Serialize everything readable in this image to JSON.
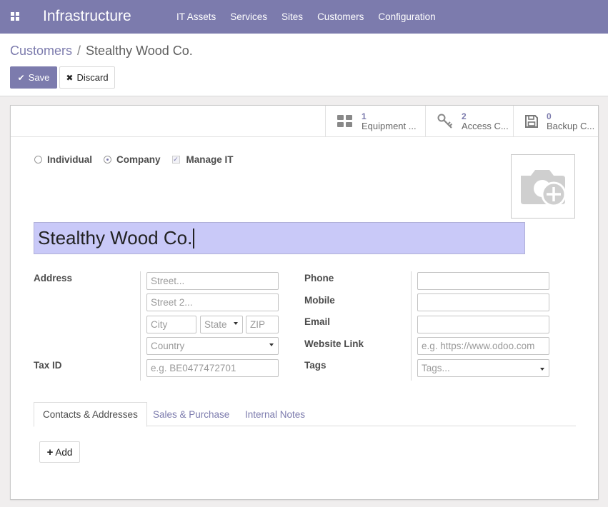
{
  "navbar": {
    "app_title": "Infrastructure",
    "menu": [
      "IT Assets",
      "Services",
      "Sites",
      "Customers",
      "Configuration"
    ]
  },
  "breadcrumb": {
    "parent": "Customers",
    "separator": "/",
    "current": "Stealthy Wood Co."
  },
  "actions": {
    "save_label": "Save",
    "discard_label": "Discard"
  },
  "stat_buttons": [
    {
      "count": "1",
      "label": "Equipment ...",
      "icon": "grid-icon"
    },
    {
      "count": "2",
      "label": "Access C...",
      "icon": "key-icon"
    },
    {
      "count": "0",
      "label": "Backup C...",
      "icon": "floppy-icon"
    }
  ],
  "type_options": {
    "individual": "Individual",
    "company": "Company",
    "manage_it": "Manage IT",
    "selected": "Company",
    "manage_it_checked": true
  },
  "name": "Stealthy Wood Co.",
  "address": {
    "label": "Address",
    "street_placeholder": "Street...",
    "street2_placeholder": "Street 2...",
    "city_placeholder": "City",
    "state_placeholder": "State",
    "zip_placeholder": "ZIP",
    "country_placeholder": "Country"
  },
  "tax": {
    "label": "Tax ID",
    "placeholder": "e.g. BE0477472701"
  },
  "contact": {
    "phone_label": "Phone",
    "mobile_label": "Mobile",
    "email_label": "Email",
    "website_label": "Website Link",
    "website_placeholder": "e.g. https://www.odoo.com",
    "tags_label": "Tags",
    "tags_placeholder": "Tags..."
  },
  "tabs": [
    "Contacts & Addresses",
    "Sales & Purchase",
    "Internal Notes"
  ],
  "active_tab": "Contacts & Addresses",
  "add_label": "Add",
  "colors": {
    "brand": "#7c7bad",
    "name_highlight": "#c9c9f8"
  }
}
